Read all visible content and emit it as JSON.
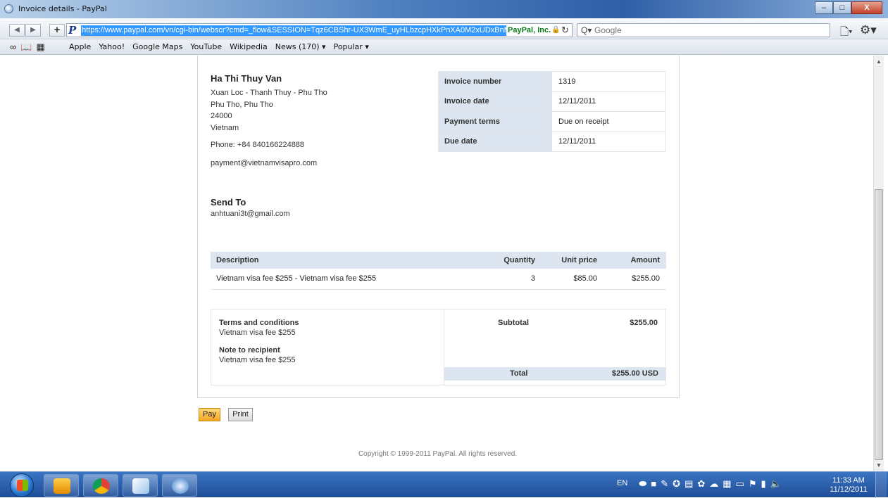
{
  "window": {
    "title": "Invoice details - PayPal",
    "controls": {
      "minimize": "–",
      "maximize": "□",
      "close": "X"
    }
  },
  "nav": {
    "back": "◀",
    "forward": "▶",
    "add": "+",
    "url": "https://www.paypal.com/vn/cgi-bin/webscr?cmd=_flow&SESSION=Tqz6CBShr-UX3WmE_uyHLbzcpHXkPnXA0M2xUDxBnMl",
    "site_identity": "PayPal, Inc.",
    "search_placeholder": "Google"
  },
  "bookmarks": [
    "Apple",
    "Yahoo!",
    "Google Maps",
    "YouTube",
    "Wikipedia",
    "News (170) ▾",
    "Popular ▾"
  ],
  "sender": {
    "name": "Ha Thi Thuy Van",
    "address_lines": [
      "Xuan Loc - Thanh Thuy - Phu Tho",
      "Phu Tho, Phu Tho",
      "24000",
      "Vietnam"
    ],
    "phone": "Phone: +84 840166224888",
    "email": "payment@vietnamvisapro.com"
  },
  "invoice_meta": [
    {
      "label": "Invoice number",
      "value": "1319"
    },
    {
      "label": "Invoice date",
      "value": "12/11/2011"
    },
    {
      "label": "Payment terms",
      "value": "Due on receipt"
    },
    {
      "label": "Due date",
      "value": "12/11/2011"
    }
  ],
  "send_to": {
    "title": "Send To",
    "email": "anhtuani3t@gmail.com"
  },
  "items_table": {
    "headers": [
      "Description",
      "Quantity",
      "Unit price",
      "Amount"
    ],
    "rows": [
      {
        "description": "Vietnam visa fee $255 - Vietnam visa fee $255",
        "quantity": "3",
        "unit_price": "$85.00",
        "amount": "$255.00"
      }
    ]
  },
  "notes": {
    "terms_title": "Terms and conditions",
    "terms_text": "Vietnam visa fee $255",
    "note_title": "Note to recipient",
    "note_text": "Vietnam visa fee $255"
  },
  "totals": {
    "subtotal_label": "Subtotal",
    "subtotal_value": "$255.00",
    "total_label": "Total",
    "total_value": "$255.00 USD"
  },
  "actions": {
    "pay": "Pay",
    "print": "Print"
  },
  "footer": {
    "copyright": "Copyright © 1999-2011 PayPal. All rights reserved."
  },
  "taskbar": {
    "apps": [
      "outlook",
      "chrome",
      "paint",
      "safari"
    ],
    "language": "EN",
    "time": "11:33 AM",
    "date": "11/12/2011"
  }
}
